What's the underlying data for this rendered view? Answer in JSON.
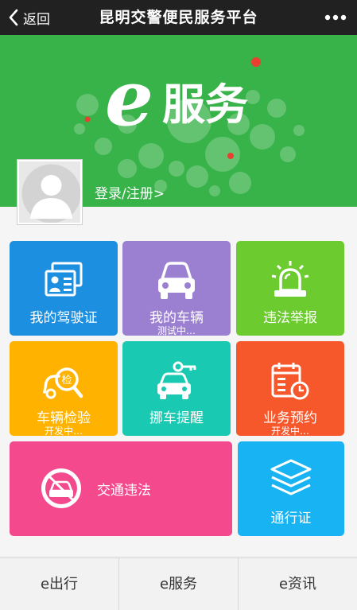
{
  "header": {
    "back_label": "返回",
    "title": "昆明交警便民服务平台"
  },
  "banner": {
    "brand_e": "e",
    "brand_text": "服务",
    "background_color": "#38b349"
  },
  "user": {
    "login_label": "登录/注册>"
  },
  "tiles": [
    {
      "label": "我的驾驶证",
      "sub": "",
      "color": "#1c8fe0"
    },
    {
      "label": "我的车辆",
      "sub": "测试中…",
      "color": "#9b7fd1"
    },
    {
      "label": "违法举报",
      "sub": "",
      "color": "#6ccb2e"
    },
    {
      "label": "车辆检验",
      "sub": "开发中…",
      "color": "#ffb300"
    },
    {
      "label": "挪车提醒",
      "sub": "",
      "color": "#19c9b1"
    },
    {
      "label": "业务预约",
      "sub": "开发中…",
      "color": "#f6582c"
    },
    {
      "label": "交通违法",
      "sub": "",
      "color": "#f44a8d"
    },
    {
      "label": "通行证",
      "sub": "",
      "color": "#17b3f2"
    }
  ],
  "tabbar": {
    "tabs": [
      {
        "label": "e出行"
      },
      {
        "label": "e服务"
      },
      {
        "label": "e资讯"
      }
    ]
  }
}
